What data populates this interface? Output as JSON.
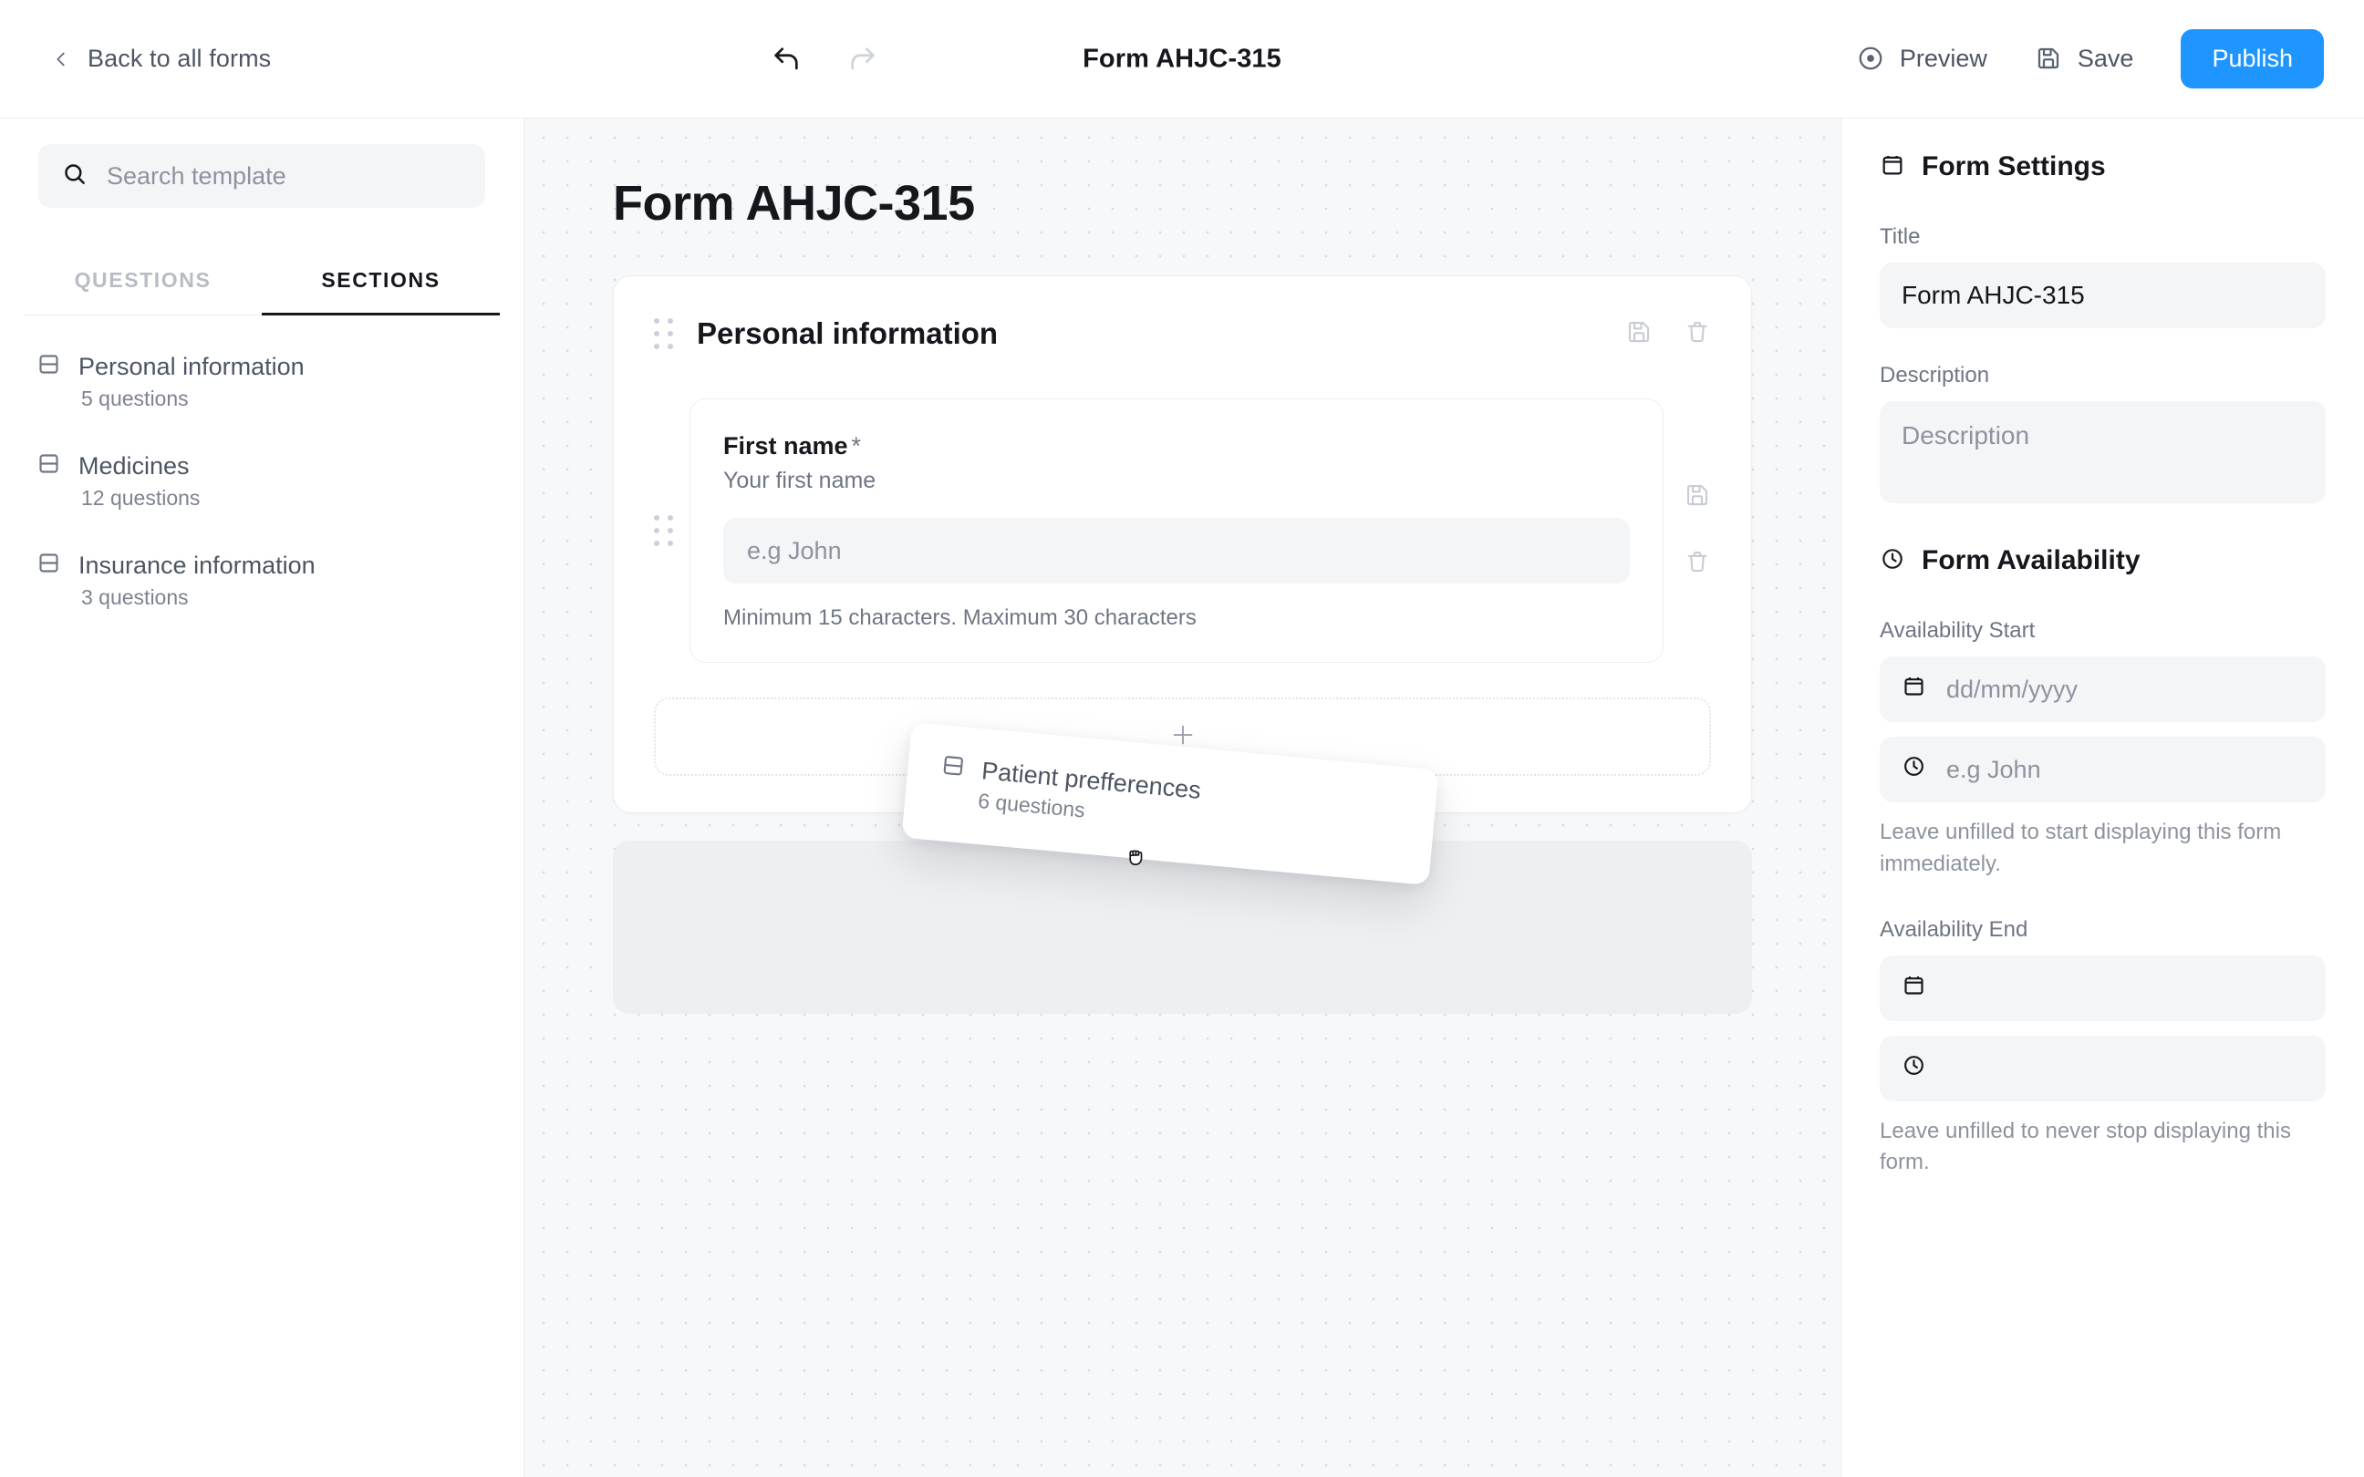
{
  "topbar": {
    "back_label": "Back to all forms",
    "back_icon": "chevron-left-icon",
    "undo_icon": "undo-arrow-icon",
    "redo_icon": "redo-arrow-icon",
    "doc_title": "Form AHJC-315",
    "preview_label": "Preview",
    "preview_icon": "eye-target-icon",
    "save_label": "Save",
    "save_icon": "floppy-disk-icon",
    "publish_label": "Publish",
    "publish_color": "#1e95ff"
  },
  "sidebar": {
    "search": {
      "icon": "search-icon",
      "placeholder": "Search template",
      "value": ""
    },
    "tabs": [
      {
        "label": "QUESTIONS",
        "active": false
      },
      {
        "label": "SECTIONS",
        "active": true
      }
    ],
    "sections": [
      {
        "name": "Personal information",
        "count": "5 questions",
        "icon": "section-rows-icon"
      },
      {
        "name": "Medicines",
        "count": "12 questions",
        "icon": "section-rows-icon"
      },
      {
        "name": "Insurance information",
        "count": "3 questions",
        "icon": "section-rows-icon"
      }
    ]
  },
  "drag_preview": {
    "name": "Patient prefferences",
    "count": "6 questions",
    "icon": "section-rows-icon",
    "cursor": "grabbing-hand-cursor"
  },
  "canvas": {
    "title": "Form AHJC-315",
    "section": {
      "title": "Personal information",
      "drag_handle_icon": "drag-dots-icon",
      "save_icon": "floppy-disk-icon",
      "delete_icon": "trash-icon",
      "add_icon": "plus-icon",
      "question": {
        "label": "First name",
        "required_marker": "*",
        "sublabel": "Your first name",
        "input_placeholder": "e.g John",
        "input_value": "",
        "help_text": "Minimum 15 characters. Maximum 30 characters",
        "drag_handle_icon": "drag-dots-icon",
        "save_icon": "floppy-disk-icon",
        "delete_icon": "trash-icon"
      }
    }
  },
  "right_panel": {
    "settings": {
      "heading": "Form Settings",
      "heading_icon": "calendar-clipboard-icon",
      "title_label": "Title",
      "title_value": "Form AHJC-315",
      "description_label": "Description",
      "description_placeholder": "Description",
      "description_value": ""
    },
    "availability": {
      "heading": "Form Availability",
      "heading_icon": "clock-icon",
      "start_label": "Availability Start",
      "start_date_icon": "calendar-icon",
      "start_date_placeholder": "dd/mm/yyyy",
      "start_date_value": "",
      "start_time_icon": "clock-icon",
      "start_time_placeholder": "e.g John",
      "start_time_value": "",
      "start_hint": "Leave unfilled to start displaying this form immediately.",
      "end_label": "Availability End",
      "end_date_icon": "calendar-icon",
      "end_date_placeholder": "",
      "end_date_value": "",
      "end_time_icon": "clock-icon",
      "end_time_placeholder": "",
      "end_time_value": "",
      "end_hint": "Leave unfilled to never stop displaying this form."
    }
  }
}
